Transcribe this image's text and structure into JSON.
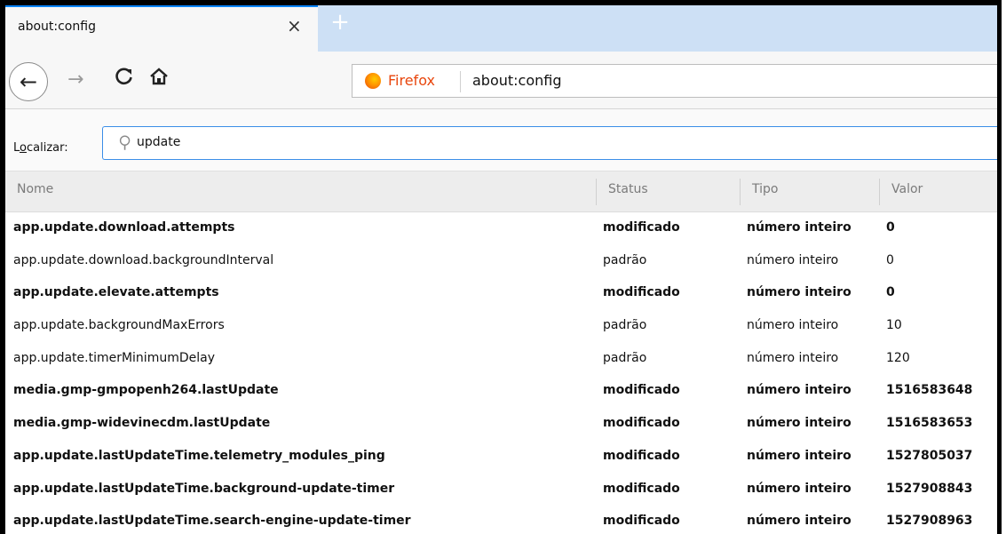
{
  "tab": {
    "title": "about:config",
    "close_glyph": "×",
    "new_tab_glyph": "+"
  },
  "nav": {
    "back_icon": "←",
    "forward_icon": "→",
    "reload_icon": "C",
    "home_icon": "⌂",
    "identity_label": "Firefox",
    "url": "about:config"
  },
  "search": {
    "label_accesskey": "o",
    "label_pre": "L",
    "label_post": "calizar:",
    "icon": "○",
    "value": "update"
  },
  "columns": {
    "name": "Nome",
    "status": "Status",
    "type": "Tipo",
    "value": "Valor"
  },
  "rows": [
    {
      "name": "app.update.download.attempts",
      "status": "modificado",
      "type": "número inteiro",
      "value": "0",
      "modified": true
    },
    {
      "name": "app.update.download.backgroundInterval",
      "status": "padrão",
      "type": "número inteiro",
      "value": "0",
      "modified": false
    },
    {
      "name": "app.update.elevate.attempts",
      "status": "modificado",
      "type": "número inteiro",
      "value": "0",
      "modified": true
    },
    {
      "name": "app.update.backgroundMaxErrors",
      "status": "padrão",
      "type": "número inteiro",
      "value": "10",
      "modified": false
    },
    {
      "name": "app.update.timerMinimumDelay",
      "status": "padrão",
      "type": "número inteiro",
      "value": "120",
      "modified": false
    },
    {
      "name": "media.gmp-gmpopenh264.lastUpdate",
      "status": "modificado",
      "type": "número inteiro",
      "value": "1516583648",
      "modified": true
    },
    {
      "name": "media.gmp-widevinecdm.lastUpdate",
      "status": "modificado",
      "type": "número inteiro",
      "value": "1516583653",
      "modified": true
    },
    {
      "name": "app.update.lastUpdateTime.telemetry_modules_ping",
      "status": "modificado",
      "type": "número inteiro",
      "value": "1527805037",
      "modified": true
    },
    {
      "name": "app.update.lastUpdateTime.background-update-timer",
      "status": "modificado",
      "type": "número inteiro",
      "value": "1527908843",
      "modified": true
    },
    {
      "name": "app.update.lastUpdateTime.search-engine-update-timer",
      "status": "modificado",
      "type": "número inteiro",
      "value": "1527908963",
      "modified": true
    }
  ],
  "colors": {
    "accent": "#0a84ff",
    "tabstrip": "#cde0f5",
    "firefox_orange": "#e8460d"
  }
}
